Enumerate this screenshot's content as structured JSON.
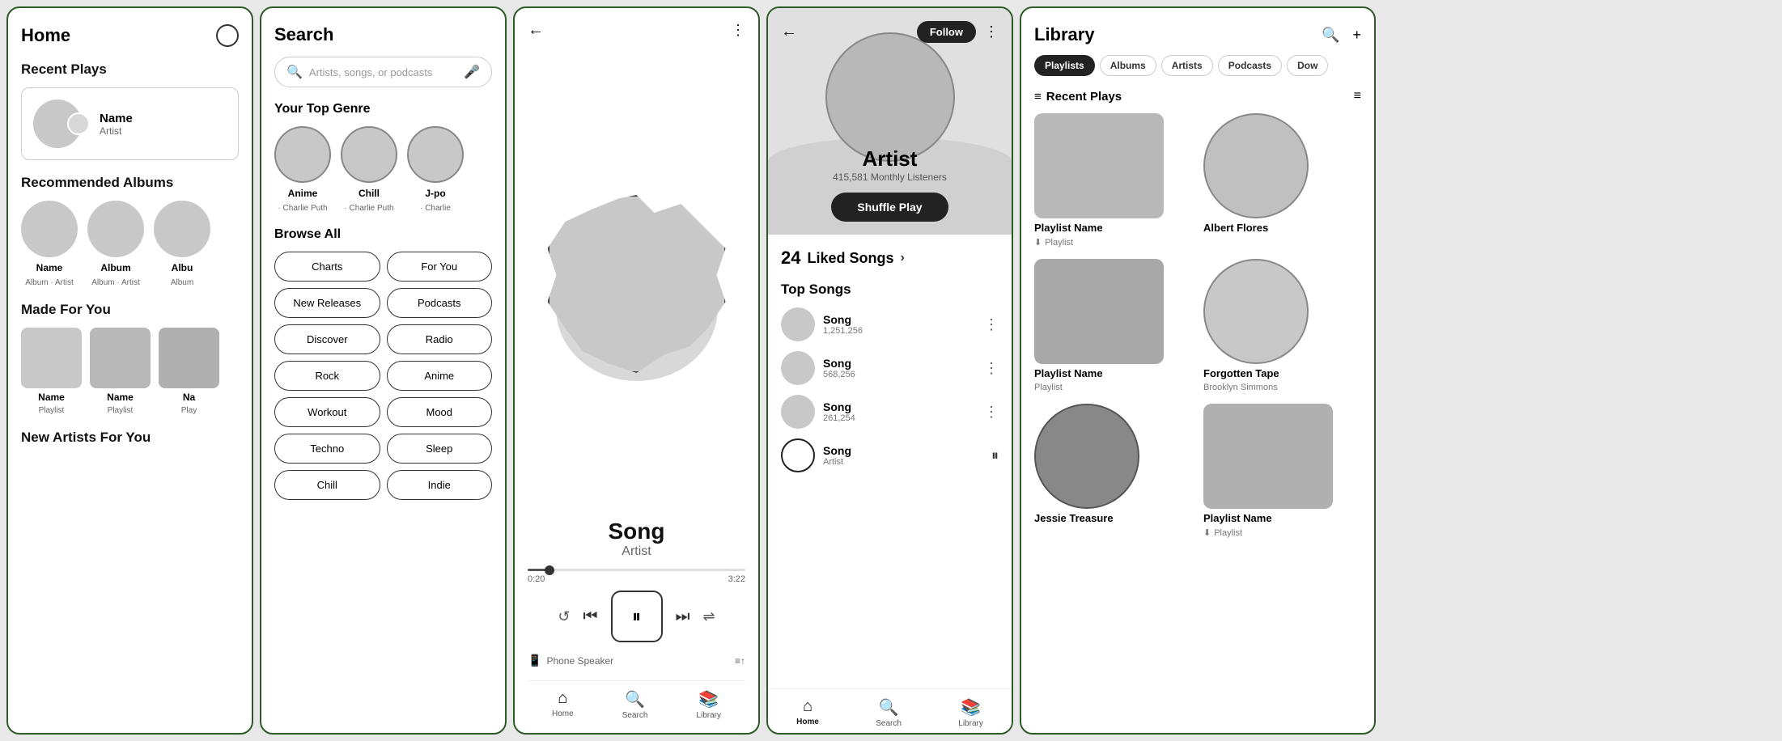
{
  "home": {
    "title": "Home",
    "recent_plays": "Recent Plays",
    "recent_name": "Name",
    "recent_artist": "Artist",
    "recommended_albums": "Recommended Albums",
    "album1_name": "Name",
    "album1_sub": "Album · Artist",
    "album2_name": "Album",
    "album2_sub": "Album · Artist",
    "album3_name": "Albu",
    "album3_sub": "Album",
    "made_for_you": "Made For You",
    "playlist1_name": "Name",
    "playlist1_sub": "Playlist",
    "playlist2_name": "Name",
    "playlist2_sub": "Playlist",
    "playlist3_name": "Na",
    "playlist3_sub": "Play",
    "new_artists": "New Artists For You"
  },
  "search": {
    "title": "Search",
    "input_placeholder": "Artists, songs, or podcasts",
    "top_genre_label": "Your Top Genre",
    "genre1_name": "Anime",
    "genre1_sub": "· Charlie Puth",
    "genre2_name": "Chill",
    "genre2_sub": "· Charlie Puth",
    "genre3_name": "J-po",
    "genre3_sub": "· Charlie",
    "browse_label": "Browse All",
    "btn_charts": "Charts",
    "btn_for_you": "For You",
    "btn_new_releases": "New Releases",
    "btn_podcasts": "Podcasts",
    "btn_discover": "Discover",
    "btn_radio": "Radio",
    "btn_rock": "Rock",
    "btn_anime": "Anime",
    "btn_workout": "Workout",
    "btn_mood": "Mood",
    "btn_techno": "Techno",
    "btn_sleep": "Sleep",
    "btn_chill": "Chill",
    "btn_indie": "Indie"
  },
  "player": {
    "song_title": "Song",
    "song_artist": "Artist",
    "progress_current": "0:20",
    "progress_total": "3:22",
    "speaker_label": "Phone Speaker",
    "nav_home": "Home",
    "nav_search": "Search",
    "nav_library": "Library"
  },
  "artist": {
    "name": "Artist",
    "listeners": "415,581 Monthly Listeners",
    "follow_label": "Follow",
    "shuffle_play": "Shuffle Play",
    "liked_count": "24",
    "liked_label": "Liked Songs",
    "top_songs_label": "Top Songs",
    "song1_name": "Song",
    "song1_plays": "1,251,256",
    "song2_name": "Song",
    "song2_plays": "568,256",
    "song3_name": "Song",
    "song3_plays": "261,254",
    "song4_name": "Song",
    "song4_artist": "Artist",
    "nav_home": "Home",
    "nav_search": "Search",
    "nav_library": "Library"
  },
  "library": {
    "title": "Library",
    "tab_playlists": "Playlists",
    "tab_albums": "Albums",
    "tab_artists": "Artists",
    "tab_podcasts": "Podcasts",
    "tab_downloads": "Dow",
    "recent_plays_label": "Recent Plays",
    "item1_name": "Playlist Name",
    "item1_sub": "Playlist",
    "item2_name": "Albert Flores",
    "item3_name": "Playlist Name",
    "item3_sub": "Playlist",
    "item4_name": "Forgotten Tape",
    "item4_sub": "Brooklyn Simmons",
    "item5_name": "Jessie Treasure",
    "item6_name": "Playlist Name",
    "item6_sub": "Playlist"
  }
}
